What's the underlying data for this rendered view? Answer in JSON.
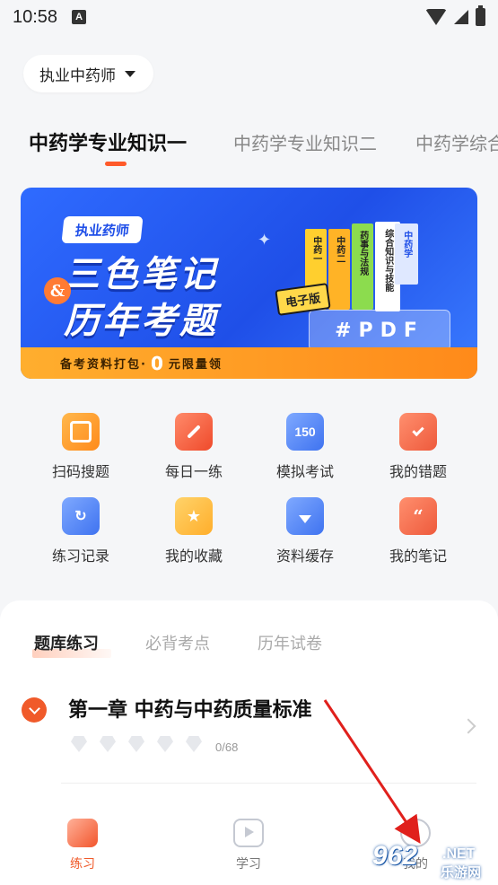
{
  "status_bar": {
    "time": "10:58",
    "ime": "A"
  },
  "selector": {
    "label": "执业中药师"
  },
  "subject_tabs": [
    {
      "label": "中药学专业知识一",
      "active": true
    },
    {
      "label": "中药学专业知识二",
      "active": false
    },
    {
      "label": "中药学综合",
      "active": false
    }
  ],
  "banner": {
    "badge": "执业药师",
    "title_line1": "三色笔记",
    "title_line2": "历年考题",
    "amp": "&",
    "ebook_tag": "电子版",
    "books": [
      "中药一",
      "中药二",
      "药事与法规",
      "综合知识与技能",
      "中药学"
    ],
    "pdf": "#PDF",
    "footer_before": "备考资料打包·",
    "footer_zero": "0",
    "footer_after": "元限量领"
  },
  "functions": [
    {
      "label": "扫码搜题",
      "icon": "scan-icon"
    },
    {
      "label": "每日一练",
      "icon": "pencil-icon"
    },
    {
      "label": "模拟考试",
      "icon": "exam-150-icon",
      "icon_text": "150"
    },
    {
      "label": "我的错题",
      "icon": "wrong-questions-icon"
    },
    {
      "label": "练习记录",
      "icon": "practice-record-icon"
    },
    {
      "label": "我的收藏",
      "icon": "favorites-icon"
    },
    {
      "label": "资料缓存",
      "icon": "download-cache-icon"
    },
    {
      "label": "我的笔记",
      "icon": "notes-icon"
    }
  ],
  "card_tabs": [
    {
      "label": "题库练习",
      "active": true
    },
    {
      "label": "必背考点",
      "active": false
    },
    {
      "label": "历年试卷",
      "active": false
    }
  ],
  "chapter": {
    "title": "第一章 中药与中药质量标准",
    "progress_text": "0/68",
    "done": 0,
    "total": 68,
    "diamonds": 5
  },
  "bottom_nav": [
    {
      "label": "练习",
      "active": true
    },
    {
      "label": "学习",
      "active": false
    },
    {
      "label": "我的",
      "active": false
    }
  ],
  "watermark": {
    "number": "962",
    "net": ".NET",
    "cn": "乐游网"
  },
  "colors": {
    "accent": "#f05a2a",
    "banner_blue": "#1f4fe8",
    "annotation_arrow": "#e0201c"
  }
}
